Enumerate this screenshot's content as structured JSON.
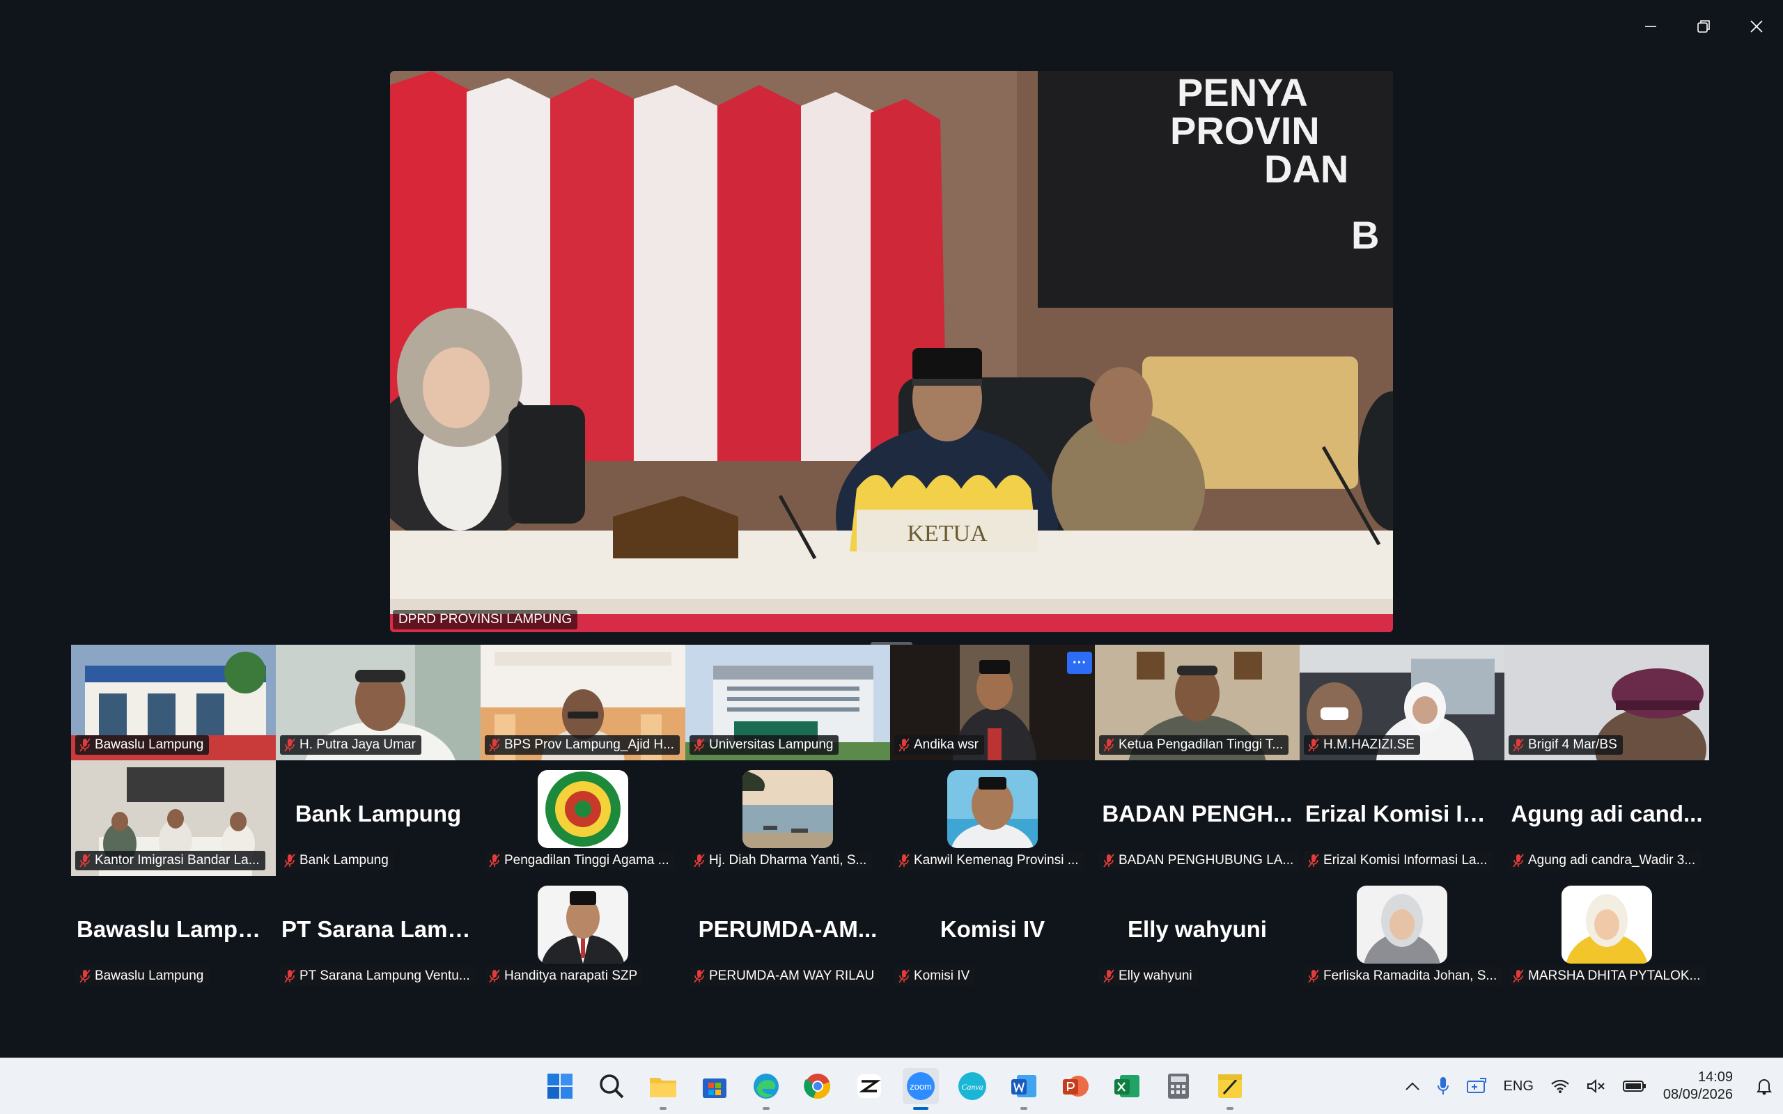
{
  "main": {
    "speaker_name": "DPRD PROVINSI LAMPUNG",
    "screen_text": [
      "PENYA",
      "PROVIN",
      "DAN",
      "B"
    ],
    "nameplate": "KETUA"
  },
  "tiles": [
    {
      "label": "Bawaslu Lampung",
      "kind": "video",
      "theme": "building"
    },
    {
      "label": "H. Putra Jaya Umar",
      "kind": "video",
      "theme": "person-light"
    },
    {
      "label": "BPS Prov Lampung_Ajid H...",
      "kind": "video",
      "theme": "slide"
    },
    {
      "label": "Universitas Lampung",
      "kind": "video",
      "theme": "campus"
    },
    {
      "label": "Andika wsr",
      "kind": "video",
      "theme": "person-dark",
      "more": "···"
    },
    {
      "label": "Ketua Pengadilan Tinggi T...",
      "kind": "video",
      "theme": "office"
    },
    {
      "label": "H.M.HAZIZI.SE",
      "kind": "video",
      "theme": "car"
    },
    {
      "label": "Brigif 4 Mar/BS",
      "kind": "video",
      "theme": "beret"
    },
    {
      "label": "Kantor Imigrasi Bandar La...",
      "kind": "video",
      "theme": "meeting"
    },
    {
      "label": "Bank Lampung",
      "kind": "name",
      "big": "Bank Lampung"
    },
    {
      "label": "Pengadilan Tinggi Agama ...",
      "kind": "avatar",
      "theme": "emblem"
    },
    {
      "label": "Hj. Diah Dharma  Yanti, S...",
      "kind": "avatar",
      "theme": "beach"
    },
    {
      "label": "Kanwil Kemenag Provinsi ...",
      "kind": "avatar",
      "theme": "man-pool"
    },
    {
      "label": "BADAN PENGHUBUNG LA...",
      "kind": "name",
      "big": "BADAN  PENGH..."
    },
    {
      "label": "Erizal Komisi Informasi La...",
      "kind": "name",
      "big": "Erizal Komisi Inf..."
    },
    {
      "label": "Agung adi candra_Wadir 3...",
      "kind": "name",
      "big": "Agung adi cand..."
    },
    {
      "label": "Bawaslu Lampung",
      "kind": "name",
      "big": "Bawaslu Lampung"
    },
    {
      "label": "PT Sarana Lampung Ventu...",
      "kind": "name",
      "big": "PT  Sarana  Lamp..."
    },
    {
      "label": "Handitya narapati SZP",
      "kind": "avatar",
      "theme": "man-suit"
    },
    {
      "label": "PERUMDA-AM WAY RILAU",
      "kind": "name",
      "big": "PERUMDA-AM..."
    },
    {
      "label": "Komisi IV",
      "kind": "name",
      "big": "Komisi IV"
    },
    {
      "label": "Elly wahyuni",
      "kind": "name",
      "big": "Elly wahyuni"
    },
    {
      "label": "Ferliska Ramadita Johan, S...",
      "kind": "avatar",
      "theme": "woman-grey"
    },
    {
      "label": "MARSHA DHITA PYTALOK...",
      "kind": "avatar",
      "theme": "woman-yellow"
    }
  ],
  "taskbar": {
    "apps": [
      "windows-start",
      "search",
      "file-explorer",
      "microsoft-store",
      "edge",
      "chrome",
      "capcut",
      "zoom",
      "canva",
      "word",
      "powerpoint",
      "excel",
      "calculator",
      "sticky-notes"
    ],
    "active": "zoom",
    "zoom_label": "zoom",
    "canva_label": "Canva",
    "lang": "ENG",
    "time": "14:09",
    "date": "08/09/2026"
  },
  "colors": {
    "background": "#10151c",
    "accent": "#2d6df6",
    "mute": "#e03c3c",
    "taskbar": "#eef1f6"
  }
}
